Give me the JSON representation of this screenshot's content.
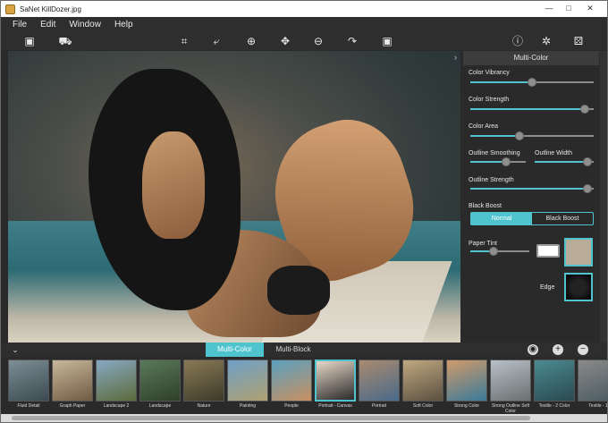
{
  "window": {
    "title": "SaNet KillDozer.jpg",
    "minimize": "—",
    "maximize": "□",
    "close": "✕"
  },
  "menu": [
    "File",
    "Edit",
    "Window",
    "Help"
  ],
  "toolbar": {
    "left": [
      {
        "name": "image-frame-icon",
        "glyph": "▣"
      },
      {
        "name": "scanner-icon",
        "glyph": "⛟"
      }
    ],
    "center": [
      {
        "name": "crop-icon",
        "glyph": "⌗"
      },
      {
        "name": "undo-icon",
        "glyph": "⤶"
      },
      {
        "name": "zoom-in-icon",
        "glyph": "⊕"
      },
      {
        "name": "move-icon",
        "glyph": "✥"
      },
      {
        "name": "zoom-out-icon",
        "glyph": "⊖"
      },
      {
        "name": "redo-icon",
        "glyph": "↷"
      },
      {
        "name": "fit-screen-icon",
        "glyph": "▣"
      }
    ],
    "right": [
      {
        "name": "info-icon",
        "glyph": "ⓘ"
      },
      {
        "name": "settings-icon",
        "glyph": "✲"
      },
      {
        "name": "random-dice-icon",
        "glyph": "⚄"
      }
    ]
  },
  "panel": {
    "header": "Multi-Color",
    "accent": "#4fc4cf",
    "color_vibrancy": {
      "label": "Color Vibrancy",
      "value": 0.5
    },
    "color_strength": {
      "label": "Color Strength",
      "value": 0.93
    },
    "color_area": {
      "label": "Color Area",
      "value": 0.4
    },
    "outline_smoothing": {
      "label": "Outline Smoothing",
      "value": 0.65
    },
    "outline_width": {
      "label": "Outline Width",
      "value": 0.9
    },
    "outline_strength": {
      "label": "Outline Strength",
      "value": 0.95
    },
    "black_boost": {
      "label": "Black Boost",
      "options": [
        "Normal",
        "Black Boost"
      ],
      "selected": "Normal"
    },
    "paper_tint": {
      "label": "Paper Tint",
      "value": 0.4
    },
    "edge": {
      "label": "Edge"
    }
  },
  "bottom_tabs": {
    "tabs": [
      "Multi-Color",
      "Multi-Block"
    ],
    "selected": "Multi-Color"
  },
  "presets": [
    {
      "label": "Fluid Detail",
      "colors": [
        "#7d8e96",
        "#3b4a50"
      ]
    },
    {
      "label": "Graph Paper",
      "colors": [
        "#c9b89a",
        "#6f5b44"
      ]
    },
    {
      "label": "Landscape 2",
      "colors": [
        "#87a8c4",
        "#5c6b3a"
      ]
    },
    {
      "label": "Landscape",
      "colors": [
        "#5a7a5a",
        "#2f3f2a"
      ]
    },
    {
      "label": "Nature",
      "colors": [
        "#8a7a55",
        "#3c3a2a"
      ]
    },
    {
      "label": "Painting",
      "colors": [
        "#6fa0c8",
        "#b0a070"
      ]
    },
    {
      "label": "People",
      "colors": [
        "#5aa0c0",
        "#c89060"
      ]
    },
    {
      "label": "Portrait - Canvas",
      "colors": [
        "#e8d8c8",
        "#2a2a2a"
      ]
    },
    {
      "label": "Portrait",
      "colors": [
        "#a88a70",
        "#4a6a8a"
      ]
    },
    {
      "label": "Soft Color",
      "colors": [
        "#c0a880",
        "#5a5040"
      ]
    },
    {
      "label": "Strong Color",
      "colors": [
        "#d09a6a",
        "#3a7a9a"
      ]
    },
    {
      "label": "Strong Outline Soft Color",
      "colors": [
        "#b8c0c8",
        "#6a7070"
      ]
    },
    {
      "label": "Textile - 2 Color",
      "colors": [
        "#4a8a90",
        "#2a4a50"
      ]
    },
    {
      "label": "Textile - 1",
      "colors": [
        "#8a8a8a",
        "#4a5a60"
      ]
    }
  ],
  "selected_preset": "Portrait - Canvas"
}
